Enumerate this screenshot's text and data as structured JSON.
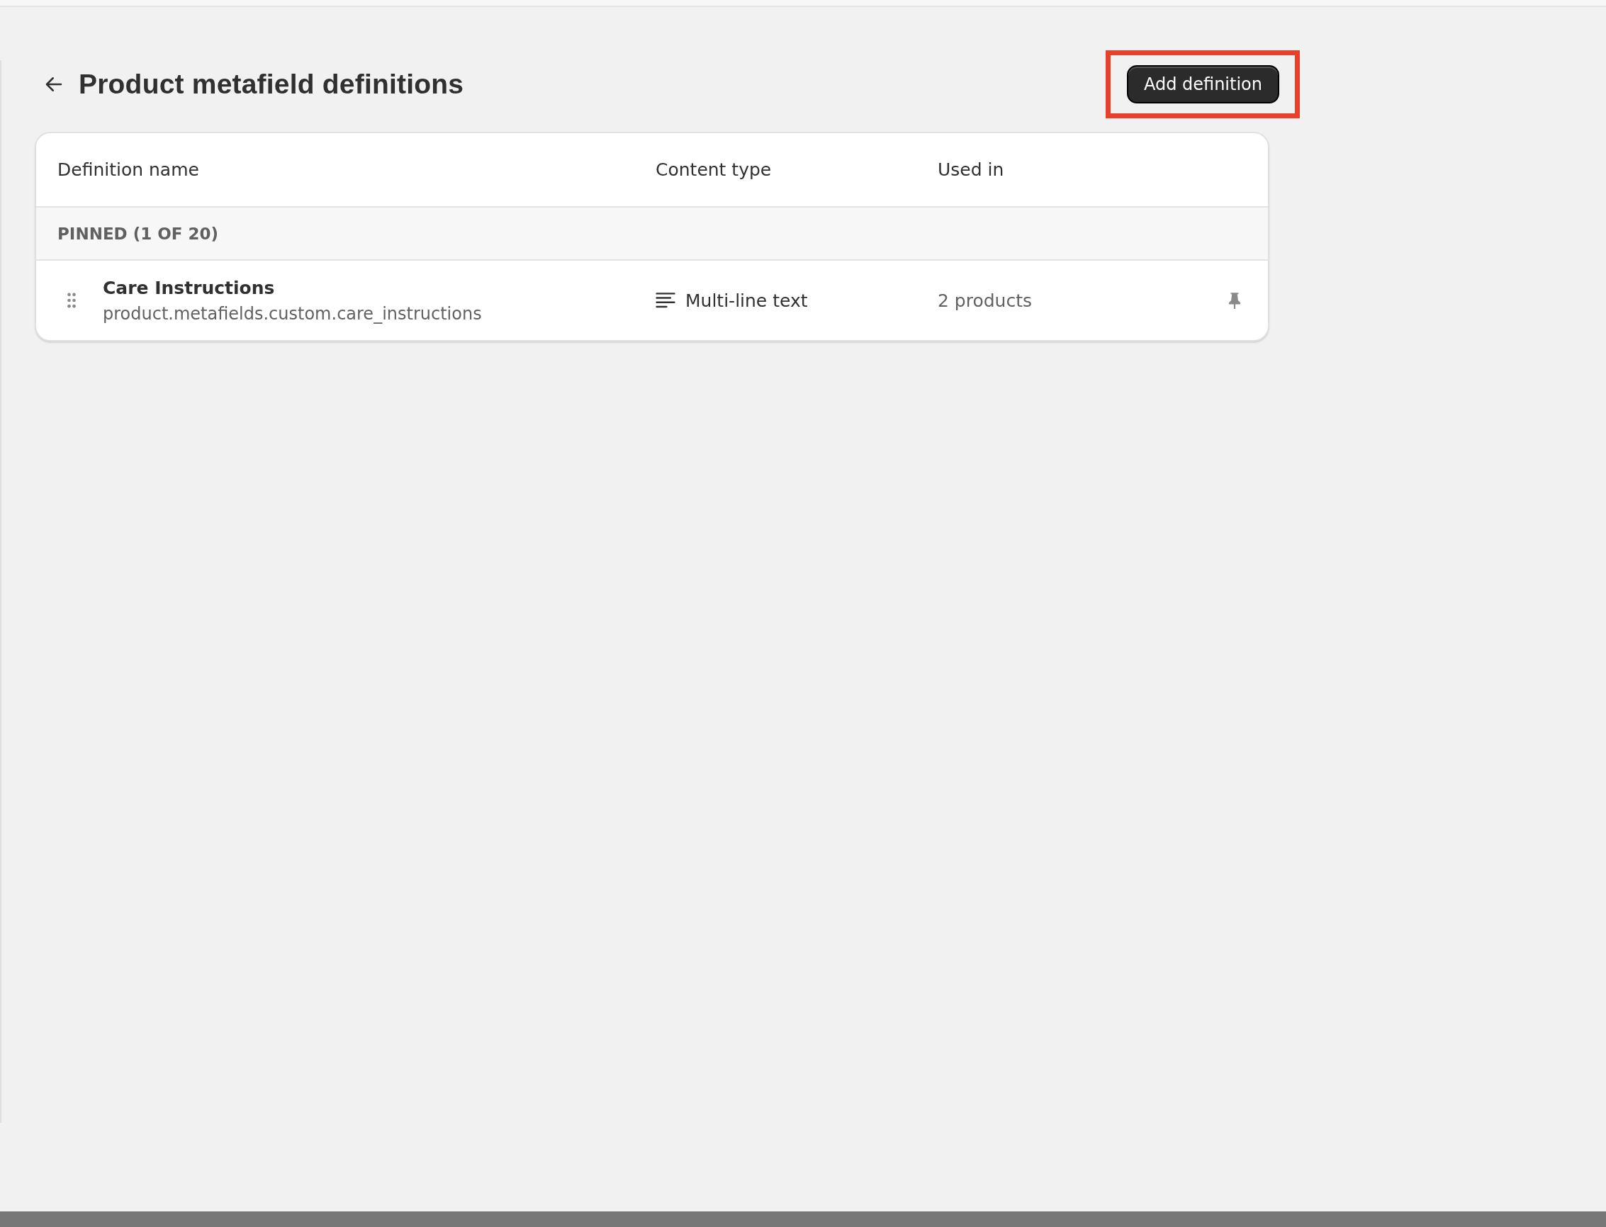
{
  "page": {
    "title": "Product metafield definitions",
    "primary_action": "Add definition"
  },
  "table": {
    "columns": [
      "Definition name",
      "Content type",
      "Used in"
    ],
    "sections": [
      {
        "heading": "PINNED (1 OF 20)",
        "rows": [
          {
            "name": "Care Instructions",
            "key": "product.metafields.custom.care_instructions",
            "content_type": "Multi-line text",
            "used_in": "2 products",
            "pinned": true
          }
        ]
      }
    ]
  }
}
